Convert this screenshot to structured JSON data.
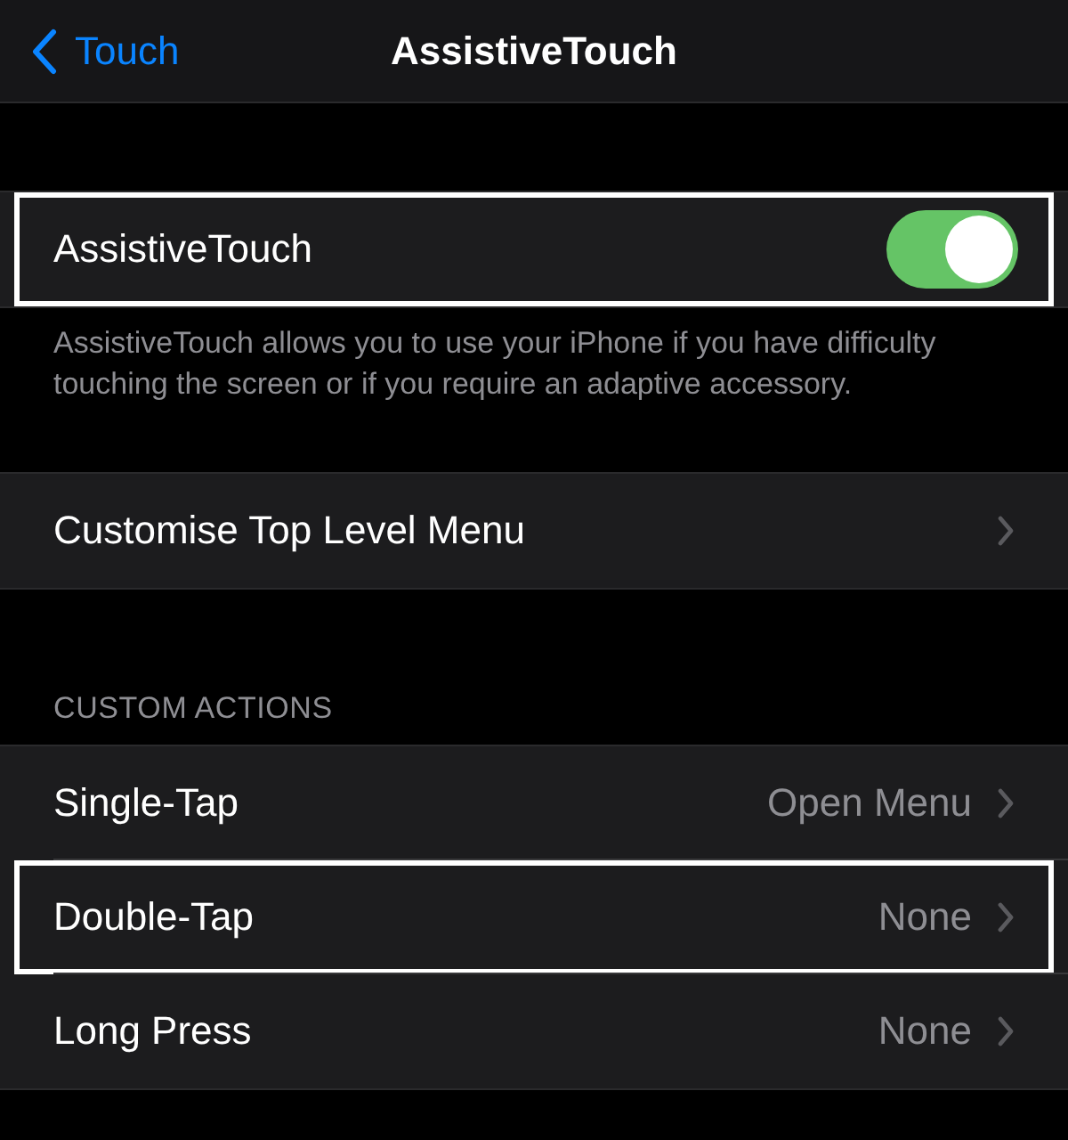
{
  "nav": {
    "back": "Touch",
    "title": "AssistiveTouch"
  },
  "sections": [
    {
      "rows": [
        {
          "kind": "toggle",
          "label": "AssistiveTouch",
          "on": true,
          "highlighted": true
        }
      ],
      "footer": "AssistiveTouch allows you to use your iPhone if you have difficulty touching the screen or if you require an adaptive accessory."
    },
    {
      "rows": [
        {
          "kind": "disclosure",
          "label": "Customise Top Level Menu",
          "highlighted": false
        }
      ]
    },
    {
      "header": "CUSTOM ACTIONS",
      "rows": [
        {
          "kind": "disclosure",
          "label": "Single-Tap",
          "value": "Open Menu",
          "highlighted": false
        },
        {
          "kind": "disclosure",
          "label": "Double-Tap",
          "value": "None",
          "highlighted": true
        },
        {
          "kind": "disclosure",
          "label": "Long Press",
          "value": "None",
          "highlighted": false
        }
      ]
    }
  ]
}
